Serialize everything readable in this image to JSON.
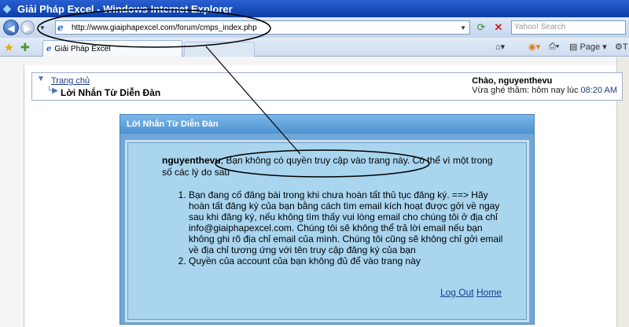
{
  "window": {
    "title": "Giải Pháp Excel - Windows Internet Explorer"
  },
  "addressbar": {
    "url": "http://www.giaiphapexcel.com/forum/cmps_index.php"
  },
  "search": {
    "placeholder": "Yahoo! Search"
  },
  "tab": {
    "title": "Giải Pháp Excel"
  },
  "commands": {
    "page": "Page",
    "tools_initial": "T"
  },
  "breadcrumb": {
    "home": "Trang chủ",
    "current": "Lời Nhắn Từ Diễn Đàn"
  },
  "welcome": {
    "greeting": "Chào, nguyenthevu",
    "last_visit_label": "Vừa ghé thăm: hôm nay lúc",
    "last_visit_time": "08:20 AM"
  },
  "panel": {
    "title": "Lời Nhắn Từ Diễn Đàn",
    "username": "nguyenthevu",
    "message": ", Bạn không có quyền truy cập vào trang này. Có thể vì một trong số các lý do sau",
    "reasons": [
      "Bạn đang cố đăng bài trong khi chưa hoàn tất thủ tục đăng ký. ==> Hãy hoàn tất đăng ký của bạn bằng cách tìm email kích hoạt được gởi về ngay sau khi đăng ký, nếu không tìm thấy vui lòng email cho chúng tôi ở địa chỉ info@giaiphapexcel.com. Chúng tôi sẽ không thể trả lời email nếu bạn không ghi rõ địa chỉ email của mình. Chúng tôi cũng sẽ không chỉ gởi email về địa chỉ tương ứng với tên truy cập đăng ký của bạn",
      "Quyền của account của bạn không đủ để vào trang này"
    ],
    "logout": "Log Out",
    "home": "Home"
  },
  "colors": {
    "titlebar": "#0a3fa8",
    "panel_header": "#4e92d0",
    "panel_body": "#a9d5ef",
    "link": "#1d3b8a"
  }
}
